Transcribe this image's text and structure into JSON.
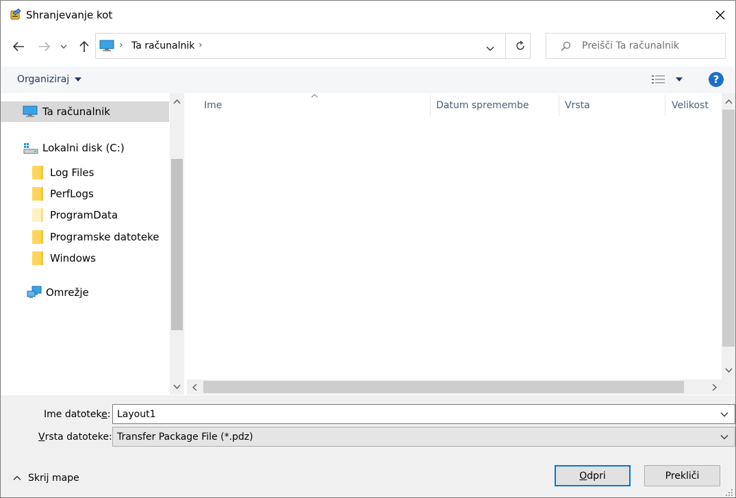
{
  "window": {
    "title": "Shranjevanje kot",
    "app_icon": "transfer-package-icon",
    "close_icon": "close-icon"
  },
  "nav": {
    "back_icon": "arrow-left-icon",
    "forward_icon": "arrow-right-icon",
    "recent_icon": "chevron-down-icon",
    "up_icon": "arrow-up-icon"
  },
  "address": {
    "path": [
      "Ta računalnik"
    ],
    "pc_icon": "computer-icon",
    "refresh_icon": "refresh-icon"
  },
  "search": {
    "placeholder": "Preišči Ta računalnik",
    "icon": "search-icon"
  },
  "toolbar": {
    "organize_label": "Organiziraj",
    "view_icon": "details-view-icon",
    "help_icon": "help-icon",
    "help_text": "?"
  },
  "sidebar": {
    "items": [
      {
        "label": "Ta računalnik",
        "icon": "computer-icon"
      },
      {
        "label": "Lokalni disk (C:)",
        "icon": "drive-icon"
      },
      {
        "label": "Log Files",
        "icon": "folder-icon"
      },
      {
        "label": "PerfLogs",
        "icon": "folder-icon"
      },
      {
        "label": "ProgramData",
        "icon": "folder-icon"
      },
      {
        "label": "Programske datoteke",
        "icon": "folder-icon"
      },
      {
        "label": "Windows",
        "icon": "folder-icon"
      },
      {
        "label": "Omrežje",
        "icon": "network-icon"
      }
    ]
  },
  "columns": {
    "name": "Ime",
    "date": "Datum spremembe",
    "type": "Vrsta",
    "size": "Velikost"
  },
  "form": {
    "filename_label_pre": "Ime datotek",
    "filename_label_u": "e",
    "filename_label_post": ":",
    "filename_value": "Layout1",
    "filetype_label_u": "V",
    "filetype_label_post": "rsta datoteke:",
    "filetype_value": "Transfer Package File (*.pdz)"
  },
  "footer": {
    "hide_folders": "Skrij mape",
    "open_u": "O",
    "open_rest": "dpri",
    "cancel": "Prekliči"
  },
  "colors": {
    "selected_bg": "#d9d9d9",
    "accent": "#0078d7",
    "help_blue": "#1e6fc8"
  }
}
